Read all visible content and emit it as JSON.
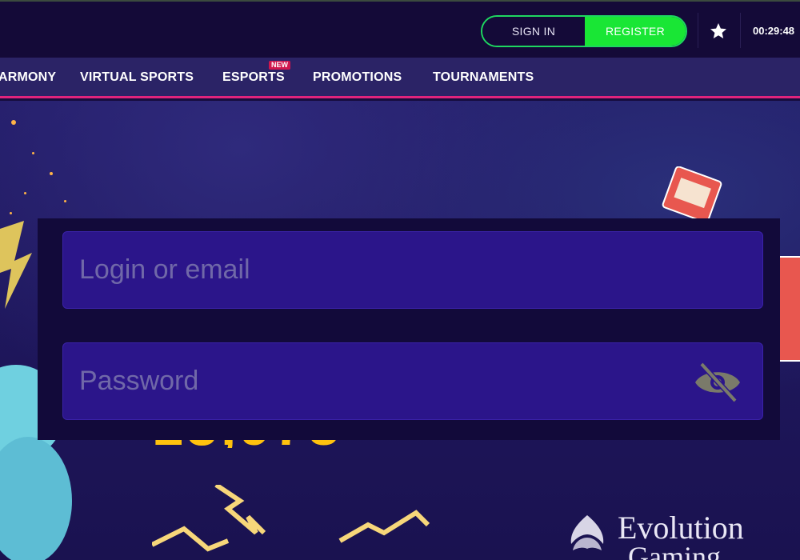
{
  "header": {
    "sign_in_label": "SIGN IN",
    "register_label": "REGISTER",
    "favorites_icon": "star-icon",
    "clock": "00:29:48"
  },
  "nav": {
    "items": [
      {
        "label": "ARMONY"
      },
      {
        "label": "VIRTUAL SPORTS"
      },
      {
        "label": "ESPORTS"
      },
      {
        "label": "PROMOTIONS"
      },
      {
        "label": "TOURNAMENTS"
      }
    ],
    "esports_badge": "NEW"
  },
  "login": {
    "login_placeholder": "Login or email",
    "password_placeholder": "Password",
    "password_toggle_icon": "eye-off-icon"
  },
  "banner": {
    "partial_text": "13,978",
    "provider_line1": "Evolution",
    "provider_line2": "Gaming"
  },
  "colors": {
    "accent_green": "#19e635",
    "nav_underline": "#e0237c",
    "badge_red": "#d0164d",
    "input_bg": "#2b158a"
  }
}
